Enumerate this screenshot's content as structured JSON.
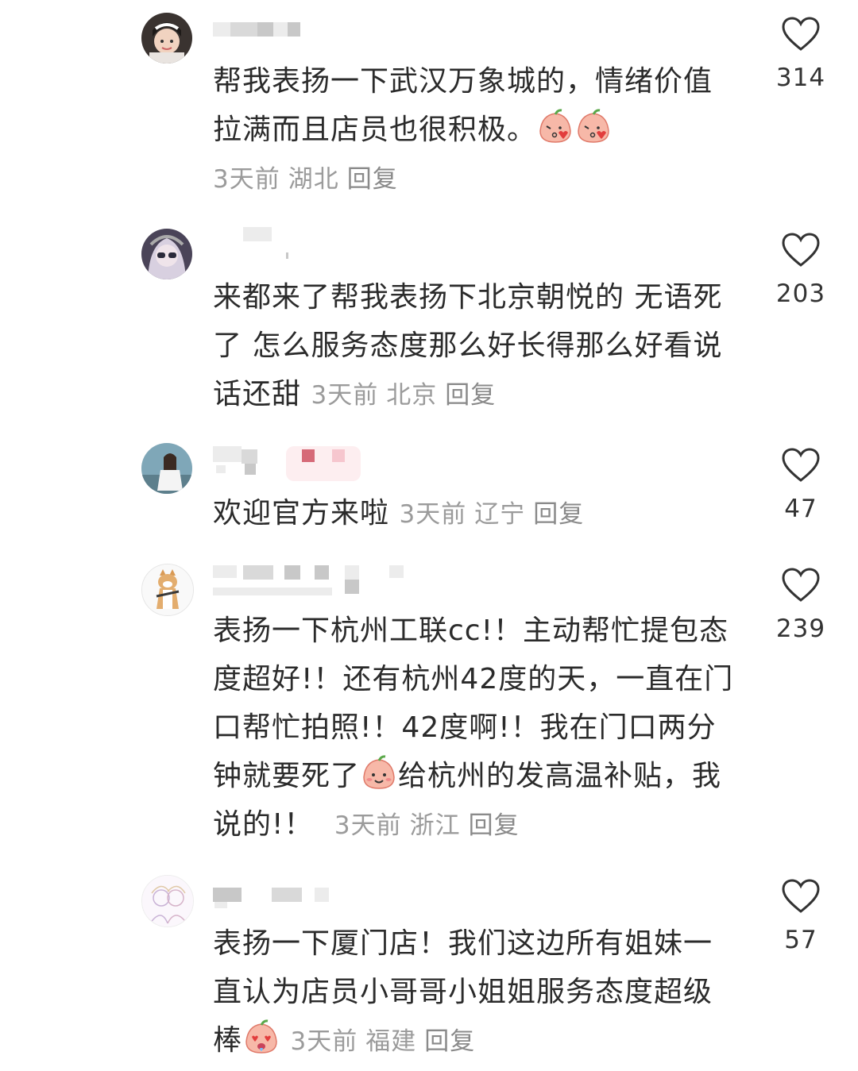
{
  "comments": [
    {
      "text": "帮我表扬一下武汉万象城的，情绪价值拉满而且店员也很积极。",
      "time": "3天前",
      "location": "湖北",
      "reply": "回复",
      "likes": "314",
      "trailing_emoji": "kiss-face-emoji x2"
    },
    {
      "text": "来都来了帮我表扬下北京朝悦的 无语死了 怎么服务态度那么好长得那么好看说话还甜",
      "time": "3天前",
      "location": "北京",
      "reply": "回复",
      "likes": "203"
    },
    {
      "text": "欢迎官方来啦",
      "time": "3天前",
      "location": "辽宁",
      "reply": "回复",
      "likes": "47"
    },
    {
      "text_part1": "表扬一下杭州工联cc!！主动帮忙提包态度超好!！还有杭州42度的天，一直在门口帮忙拍照!！42度啊!！我在门口两分钟就要死了",
      "text_part2": "给杭州的发高温补贴，我说的!！",
      "time": "3天前",
      "location": "浙江",
      "reply": "回复",
      "likes": "239",
      "inline_emoji": "smile-face-emoji"
    },
    {
      "text": "表扬一下厦门店！我们这边所有姐妹一直认为店员小哥哥小姐姐服务态度超级棒",
      "time": "3天前",
      "location": "福建",
      "reply": "回复",
      "likes": "57",
      "trailing_emoji": "heart-eyes-face-emoji"
    }
  ],
  "colors": {
    "text": "#2b2b2b",
    "meta": "#9b9b9b",
    "emoji_face": "#f7b8a8",
    "emoji_leaf": "#5aa84a"
  }
}
